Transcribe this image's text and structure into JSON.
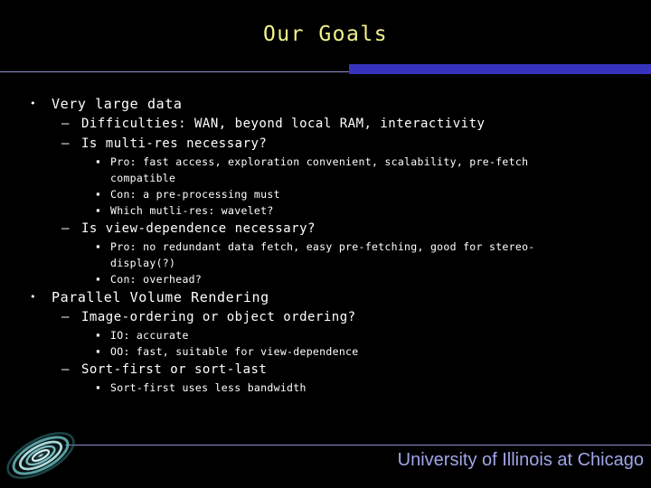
{
  "slide": {
    "title": "Our Goals",
    "title_color": "#f2f288",
    "background_color": "#000000",
    "accent_bar_color": "#3733bf",
    "rule_color": "#8d8fd0"
  },
  "bullets": [
    {
      "level": 1,
      "marker": "•",
      "text": "Very large data"
    },
    {
      "level": 2,
      "marker": "–",
      "text": "Difficulties: WAN, beyond local RAM, interactivity"
    },
    {
      "level": 2,
      "marker": "–",
      "text": "Is multi-res necessary?"
    },
    {
      "level": 3,
      "marker": "▪",
      "text": "Pro: fast access, exploration convenient, scalability, pre-fetch"
    },
    {
      "level": 3,
      "marker": "",
      "text": "compatible",
      "continuation": true
    },
    {
      "level": 3,
      "marker": "▪",
      "text": "Con: a pre-processing must"
    },
    {
      "level": 3,
      "marker": "▪",
      "text": "Which mutli-res: wavelet?"
    },
    {
      "level": 2,
      "marker": "–",
      "text": "Is view-dependence necessary?"
    },
    {
      "level": 3,
      "marker": "▪",
      "text": "Pro: no redundant data fetch, easy pre-fetching, good for stereo-"
    },
    {
      "level": 3,
      "marker": "",
      "text": "display(?)",
      "continuation": true
    },
    {
      "level": 3,
      "marker": "▪",
      "text": "Con: overhead?"
    },
    {
      "level": 1,
      "marker": "•",
      "text": "Parallel Volume Rendering"
    },
    {
      "level": 2,
      "marker": "–",
      "text": "Image-ordering or object ordering?"
    },
    {
      "level": 3,
      "marker": "▪",
      "text": "IO: accurate"
    },
    {
      "level": 3,
      "marker": "▪",
      "text": "OO: fast, suitable for view-dependence"
    },
    {
      "level": 2,
      "marker": "–",
      "text": "Sort-first or sort-last"
    },
    {
      "level": 3,
      "marker": "▪",
      "text": "Sort-first uses less bandwidth"
    }
  ],
  "footer": {
    "organization": "University of Illinois at Chicago",
    "organization_color": "#9fa6e8",
    "logo_name": "spiral-galaxy-logo"
  }
}
